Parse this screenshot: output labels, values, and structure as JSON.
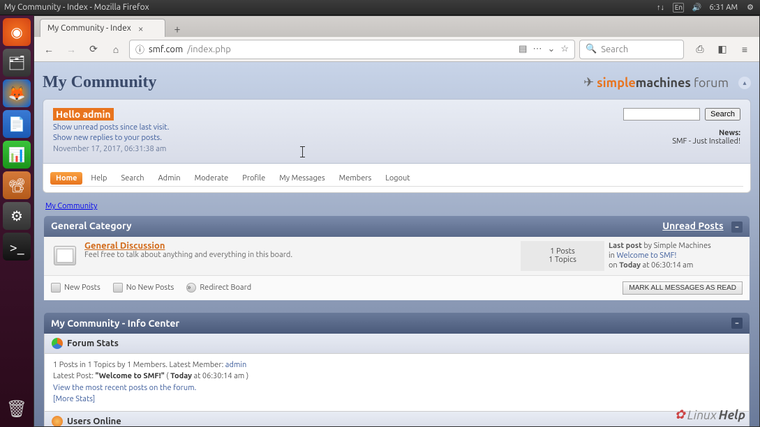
{
  "menubar": {
    "title": "My Community - Index - Mozilla Firefox",
    "lang": "En",
    "time": "6:31 AM"
  },
  "tab": {
    "title": "My Community - Index"
  },
  "url": {
    "icon": "ⓘ",
    "host": "smf.com",
    "path": "/index.php"
  },
  "searchbar": {
    "placeholder": "Search"
  },
  "forum": {
    "title": "My Community",
    "logo_pre": "simple",
    "logo_mid": "machines",
    "logo_suf": " forum"
  },
  "user": {
    "hello": "Hello admin",
    "link1": "Show unread posts since last visit.",
    "link2": "Show new replies to your posts.",
    "datetime": "November 17, 2017, 06:31:38 am"
  },
  "search_btn": "Search",
  "news": {
    "label": "News:",
    "text": "SMF - Just Installed!"
  },
  "menu": {
    "home": "Home",
    "help": "Help",
    "search": "Search",
    "admin": "Admin",
    "moderate": "Moderate",
    "profile": "Profile",
    "mymsg": "My Messages",
    "members": "Members",
    "logout": "Logout"
  },
  "breadcrumb": "My Community",
  "category": {
    "name": "General Category",
    "unread": "Unread Posts"
  },
  "board": {
    "name": "General Discussion",
    "desc": "Feel free to talk about anything and everything in this board.",
    "posts": "1 Posts",
    "topics": "1 Topics",
    "last_label": "Last post",
    "last_by": " by Simple Machines",
    "last_in_pre": "in ",
    "last_in": "Welcome to SMF!",
    "last_on_pre": "on ",
    "last_on_b": "Today",
    "last_on_time": " at 06:30:14 am"
  },
  "legend": {
    "new": "New Posts",
    "nonew": "No New Posts",
    "redir": "Redirect Board",
    "markread": "MARK ALL MESSAGES AS READ"
  },
  "info": {
    "header": "My Community - Info Center",
    "stats_title": "Forum Stats",
    "stats_l1_pre": "1 Posts in 1 Topics by 1 Members. Latest Member: ",
    "stats_l1_member": "admin",
    "stats_l2_pre": "Latest Post: ",
    "stats_l2_q": "\"Welcome to SMF!\"",
    "stats_l2_mid": " ( ",
    "stats_l2_b": "Today",
    "stats_l2_end": " at 06:30:14 am )",
    "stats_l3": "View the most recent posts on the forum.",
    "stats_l4": "[More Stats]",
    "users_title": "Users Online"
  },
  "linuxhelp": {
    "pre": "Linux",
    "suf": "Help"
  }
}
